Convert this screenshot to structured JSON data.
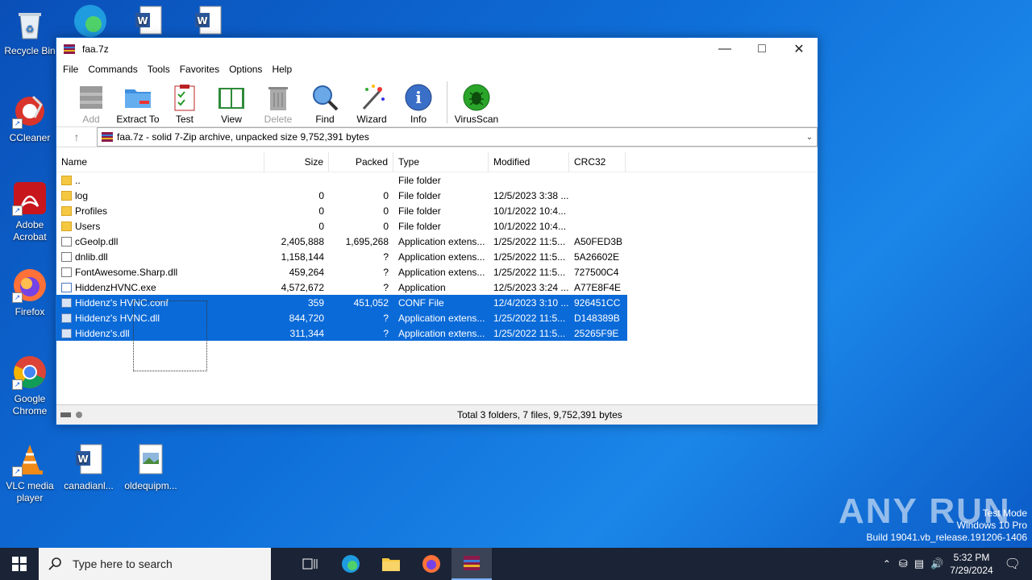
{
  "desktop": {
    "icons": [
      {
        "label": "Recycle Bin"
      },
      {
        "label": "CCleaner"
      },
      {
        "label": "Adobe Acrobat"
      },
      {
        "label": "Firefox"
      },
      {
        "label": "Google Chrome"
      },
      {
        "label": "VLC media player"
      },
      {
        "label": "canadianl..."
      },
      {
        "label": "oldequipm..."
      }
    ]
  },
  "window": {
    "title": "faa.7z",
    "menu": [
      "File",
      "Commands",
      "Tools",
      "Favorites",
      "Options",
      "Help"
    ],
    "toolbar": [
      {
        "label": "Add",
        "icon": "add-icon"
      },
      {
        "label": "Extract To",
        "icon": "extract-folder-icon"
      },
      {
        "label": "Test",
        "icon": "test-clipboard-icon"
      },
      {
        "label": "View",
        "icon": "view-book-icon"
      },
      {
        "label": "Delete",
        "icon": "trash-icon"
      },
      {
        "label": "Find",
        "icon": "magnifier-icon"
      },
      {
        "label": "Wizard",
        "icon": "wand-icon"
      },
      {
        "label": "Info",
        "icon": "info-icon"
      },
      {
        "label": "VirusScan",
        "icon": "bug-icon"
      }
    ],
    "address": "faa.7z - solid 7-Zip archive, unpacked size 9,752,391 bytes",
    "columns": {
      "name": "Name",
      "size": "Size",
      "packed": "Packed",
      "type": "Type",
      "modified": "Modified",
      "crc": "CRC32"
    },
    "files": [
      {
        "name": "..",
        "size": "",
        "packed": "",
        "type": "File folder",
        "modified": "",
        "crc": ""
      },
      {
        "name": "log",
        "size": "0",
        "packed": "0",
        "type": "File folder",
        "modified": "12/5/2023 3:38 ...",
        "crc": ""
      },
      {
        "name": "Profiles",
        "size": "0",
        "packed": "0",
        "type": "File folder",
        "modified": "10/1/2022 10:4...",
        "crc": ""
      },
      {
        "name": "Users",
        "size": "0",
        "packed": "0",
        "type": "File folder",
        "modified": "10/1/2022 10:4...",
        "crc": ""
      },
      {
        "name": "cGeolp.dll",
        "size": "2,405,888",
        "packed": "1,695,268",
        "type": "Application extens...",
        "modified": "1/25/2022 11:5...",
        "crc": "A50FED3B"
      },
      {
        "name": "dnlib.dll",
        "size": "1,158,144",
        "packed": "?",
        "type": "Application extens...",
        "modified": "1/25/2022 11:5...",
        "crc": "5A26602E"
      },
      {
        "name": "FontAwesome.Sharp.dll",
        "size": "459,264",
        "packed": "?",
        "type": "Application extens...",
        "modified": "1/25/2022 11:5...",
        "crc": "727500C4"
      },
      {
        "name": "HiddenzHVNC.exe",
        "size": "4,572,672",
        "packed": "?",
        "type": "Application",
        "modified": "12/5/2023 3:24 ...",
        "crc": "A77E8F4E"
      },
      {
        "name": "Hiddenz's HVNC.conf",
        "size": "359",
        "packed": "451,052",
        "type": "CONF File",
        "modified": "12/4/2023 3:10 ...",
        "crc": "926451CC"
      },
      {
        "name": "Hiddenz's HVNC.dll",
        "size": "844,720",
        "packed": "?",
        "type": "Application extens...",
        "modified": "1/25/2022 11:5...",
        "crc": "D148389B"
      },
      {
        "name": "Hiddenz's.dll",
        "size": "311,344",
        "packed": "?",
        "type": "Application extens...",
        "modified": "1/25/2022 11:5...",
        "crc": "25265F9E"
      }
    ],
    "status": "Total 3 folders, 7 files, 9,752,391 bytes"
  },
  "taskbar": {
    "search_placeholder": "Type here to search",
    "time": "5:32 PM",
    "date": "7/29/2024"
  },
  "watermark": {
    "brand": "ANY RUN",
    "line1": "Test Mode",
    "line2": "Windows 10 Pro",
    "line3": "Build 19041.vb_release.191206-1406"
  }
}
